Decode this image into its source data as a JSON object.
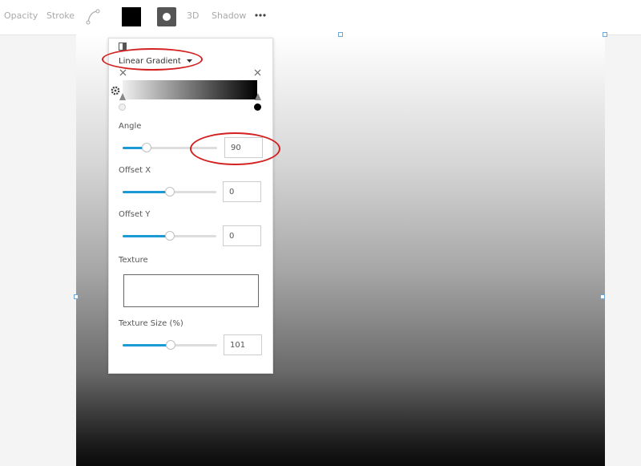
{
  "toolbar": {
    "opacity_label": "Opacity",
    "stroke_label": "Stroke",
    "curve_icon": "bezier-curve-icon",
    "fill_color": "#000000",
    "stroke_style_icon": "circle-dot-icon",
    "threed_label": "3D",
    "shadow_label": "Shadow",
    "more_icon": "ellipsis-icon"
  },
  "panel": {
    "fill_type": "Linear Gradient",
    "gradient": {
      "stop_start_color": "#f0f0f0",
      "stop_end_color": "#000000"
    },
    "angle": {
      "label": "Angle",
      "value": "90",
      "slider_fraction": 0.25
    },
    "offset_x": {
      "label": "Offset X",
      "value": "0",
      "slider_fraction": 0.5
    },
    "offset_y": {
      "label": "Offset Y",
      "value": "0",
      "slider_fraction": 0.5
    },
    "texture": {
      "label": "Texture"
    },
    "texture_size": {
      "label": "Texture Size (%)",
      "value": "101",
      "slider_fraction": 0.505
    }
  },
  "colors": {
    "accent": "#1b9ad6",
    "annotation": "#d32020"
  }
}
